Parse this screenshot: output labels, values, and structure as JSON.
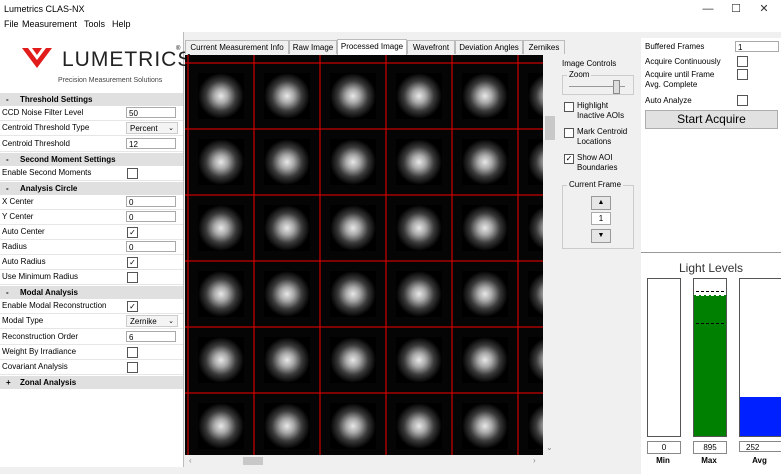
{
  "window": {
    "title": "Lumetrics CLAS-NX",
    "minimize": "—",
    "maximize": "☐",
    "close": "✕"
  },
  "menu": [
    "File",
    "Measurement",
    "Tools",
    "Help"
  ],
  "logo": {
    "word": "LUMETRICS",
    "reg": "®",
    "tagline": "Precision Measurement Solutions"
  },
  "sections": {
    "threshold": "Threshold Settings",
    "second_moment": "Second Moment Settings",
    "analysis_circle": "Analysis Circle",
    "modal": "Modal Analysis",
    "zonal": "Zonal Analysis"
  },
  "props": {
    "ccd_noise": {
      "label": "CCD Noise Filter Level",
      "value": "50"
    },
    "centroid_type": {
      "label": "Centroid Threshold Type",
      "value": "Percent"
    },
    "centroid_threshold": {
      "label": "Centroid Threshold",
      "value": "12"
    },
    "enable_second": {
      "label": "Enable Second Moments",
      "checked": ""
    },
    "x_center": {
      "label": "X Center",
      "value": "0"
    },
    "y_center": {
      "label": "Y Center",
      "value": "0"
    },
    "auto_center": {
      "label": "Auto Center",
      "checked": "✓"
    },
    "radius": {
      "label": "Radius",
      "value": "0"
    },
    "auto_radius": {
      "label": "Auto Radius",
      "checked": "✓"
    },
    "use_min_radius": {
      "label": "Use Minimum Radius",
      "checked": ""
    },
    "enable_modal": {
      "label": "Enable Modal Reconstruction",
      "checked": "✓"
    },
    "modal_type": {
      "label": "Modal Type",
      "value": "Zernike"
    },
    "recon_order": {
      "label": "Reconstruction Order",
      "value": "6"
    },
    "weight_irr": {
      "label": "Weight By Irradiance",
      "checked": ""
    },
    "covariant": {
      "label": "Covariant Analysis",
      "checked": ""
    }
  },
  "tabs": [
    "Current Measurement Info",
    "Raw Image",
    "Processed Image",
    "Wavefront",
    "Deviation Angles",
    "Zernikes"
  ],
  "active_tab": "Processed Image",
  "image_controls": {
    "title": "Image Controls",
    "zoom": "Zoom",
    "highlight": "Highlight Inactive AOIs",
    "mark_centroid": "Mark Centroid Locations",
    "show_aoi": "Show AOI Boundaries",
    "current_frame": "Current Frame",
    "frame_value": "1",
    "up": "▲",
    "down": "▼"
  },
  "right": {
    "buffered_frames_label": "Buffered Frames",
    "buffered_frames_value": "1",
    "acquire_cont": "Acquire Continuously",
    "acquire_until": "Acquire until Frame Avg. Complete",
    "auto_analyze": "Auto Analyze",
    "start": "Start Acquire"
  },
  "light_levels": {
    "title": "Light Levels",
    "bars": [
      {
        "label": "Min",
        "value": "0",
        "fill": 0.0,
        "color": "#ffffff"
      },
      {
        "label": "Max",
        "value": "895",
        "fill": 0.9,
        "color": "#008000"
      },
      {
        "label": "Avg",
        "value": "252",
        "fill": 0.25,
        "color": "#0020ff"
      }
    ]
  }
}
